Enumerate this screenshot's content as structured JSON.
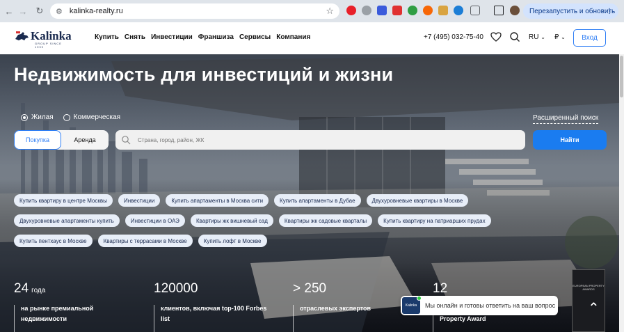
{
  "browser": {
    "url": "kalinka-realty.ru",
    "relaunch_label": "Перезапустить и обновить"
  },
  "header": {
    "logo_text": "Kalinka",
    "logo_since": "GROUP SINCE 1999",
    "menu": [
      "Купить",
      "Снять",
      "Инвестиции",
      "Франшиза",
      "Сервисы",
      "Компания"
    ],
    "phone": "+7 (495) 032-75-40",
    "lang": "RU",
    "currency": "₽",
    "login_label": "Вход"
  },
  "hero": {
    "title": "Недвижимость для инвестиций и жизни",
    "property_types": [
      "Жилая",
      "Коммерческая"
    ],
    "selected_property_type": "Жилая",
    "advanced_search": "Расширенный поиск",
    "deal_types": [
      "Покупка",
      "Аренда"
    ],
    "selected_deal_type": "Покупка",
    "search_placeholder": "Страна, город, район, ЖК",
    "find_label": "Найти"
  },
  "quick_links": [
    [
      "Купить квартиру в центре Москвы",
      "Инвестиции",
      "Купить апартаменты в Москва сити",
      "Купить апартаменты в Дубае",
      "Двухуровневые квартиры в Москве"
    ],
    [
      "Двухуровневые апартаменты купить",
      "Инвестиции в ОАЭ",
      "Квартиры жк вишневый сад",
      "Квартиры жк садовые кварталы",
      "Купить квартиру на патриарших прудах"
    ],
    [
      "Купить пентхаус в Москве",
      "Квартиры с террасами в Москве",
      "Купить лофт в Москве"
    ]
  ],
  "stats": [
    {
      "value": "24",
      "unit": "года",
      "desc1": "на рынке премиальной",
      "desc2": "недвижимости"
    },
    {
      "value": "120000",
      "unit": "",
      "desc1": "клиентов, включая top-100 Forbes",
      "desc2": "list"
    },
    {
      "value": "> 250",
      "unit": "",
      "desc1": "отраслевых экспертов",
      "desc2": ""
    },
    {
      "value": "12",
      "unit": "",
      "desc1": "",
      "desc2": "Property Award"
    }
  ],
  "award_text": "EUROPEAN PROPERTY AWARDS",
  "chat": {
    "avatar_text": "Kalinka",
    "message": "Мы онлайн и готовы ответить на ваш вопрос"
  }
}
